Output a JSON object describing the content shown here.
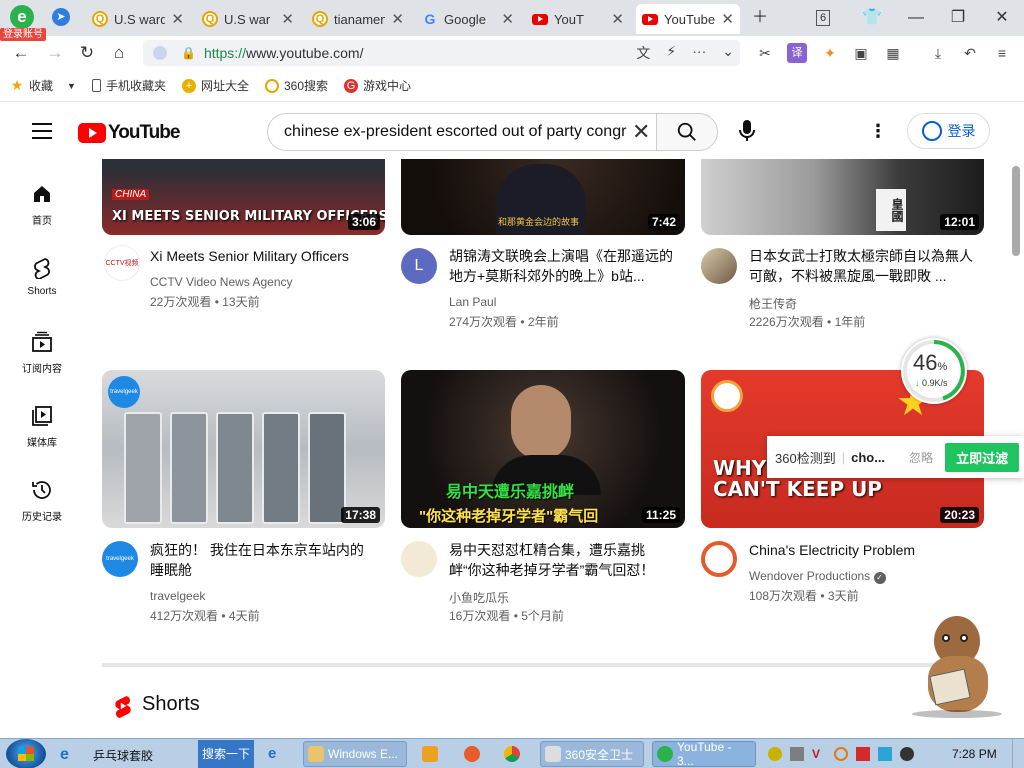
{
  "browser": {
    "login_badge": "登录账号",
    "tabs": [
      {
        "label": "U.S ward",
        "icon": "search-q-icon"
      },
      {
        "label": "U.S war",
        "icon": "search-q-icon"
      },
      {
        "label": "tianamen",
        "icon": "search-q-icon"
      },
      {
        "label": "Google",
        "icon": "google-icon"
      },
      {
        "label": "YouT",
        "icon": "youtube-icon"
      },
      {
        "label": "YouTube",
        "icon": "youtube-icon"
      }
    ],
    "tab_count": "6",
    "url_prefix": "https://",
    "url_rest": "www.youtube.com/",
    "bookmarks": [
      {
        "label": "收藏",
        "icon": "star-icon"
      },
      {
        "label": "手机收藏夹",
        "icon": "phone-icon"
      },
      {
        "label": "网址大全",
        "icon": "nav-icon"
      },
      {
        "label": "360搜索",
        "icon": "360-search-icon"
      },
      {
        "label": "游戏中心",
        "icon": "game-icon"
      }
    ]
  },
  "youtube": {
    "logo_text": "YouTube",
    "search_value": "chinese ex-president escorted out of party congr",
    "signin_label": "登录",
    "sidebar": [
      {
        "label": "首页"
      },
      {
        "label": "Shorts"
      },
      {
        "label": "订阅内容"
      },
      {
        "label": "媒体库"
      },
      {
        "label": "历史记录"
      }
    ],
    "videos": [
      {
        "thumb_text": "XI MEETS SENIOR MILITARY OFFICERS",
        "thumb_tag": "CHINA",
        "duration": "3:06",
        "avatar_text": "CCTV视频",
        "title": "Xi Meets Senior Military Officers",
        "channel": "CCTV Video News Agency",
        "views": "22万次观看",
        "age": "13天前"
      },
      {
        "thumb_text": "和那黄金会边的故事",
        "duration": "7:42",
        "avatar_text": "L",
        "title": "胡锦涛文联晚会上演唱《在那遥远的地方+莫斯科郊外的晚上》b站...",
        "channel": "Lan Paul",
        "views": "274万次观看",
        "age": "2年前"
      },
      {
        "thumb_text": "皇國",
        "duration": "12:01",
        "avatar_text": "",
        "title": "日本女武士打敗太極宗師自以為無人可敵，不料被黑旋風一戰即敗 ...",
        "channel": "枪王传奇",
        "views": "2226万次观看",
        "age": "1年前"
      },
      {
        "thumb_text": "travelgeek",
        "duration": "17:38",
        "avatar_text": "travelgeek",
        "title": "疯狂的！ 我住在日本东京车站内的睡眠舱",
        "channel": "travelgeek",
        "views": "412万次观看",
        "age": "4天前"
      },
      {
        "thumb_text": "易中天遭乐嘉挑衅",
        "thumb_text2": "\"你这种老掉牙学者\"霸气回",
        "duration": "11:25",
        "avatar_text": "",
        "title": "易中天怼怼杠精合集，遭乐嘉挑衅“你这种老掉牙学者”霸气回怼！",
        "channel": "小鱼吃瓜乐",
        "views": "16万次观看",
        "age": "5个月前"
      },
      {
        "thumb_text": "WHY THEIR GRID CAN'T KEEP UP",
        "duration": "20:23",
        "avatar_text": "",
        "title": "China's Electricity Problem",
        "channel": "Wendover Productions",
        "views": "108万次观看",
        "age": "3天前"
      }
    ],
    "shorts_heading": "Shorts"
  },
  "overlay": {
    "gauge_percent": "46",
    "gauge_unit": "%",
    "gauge_speed": "0.9K/s",
    "notice_text": "360检测到",
    "notice_query": "cho...",
    "notice_ignore": "忽略",
    "notice_button": "立即过滤"
  },
  "taskbar": {
    "ie_text": "乒乓球套胶",
    "search_button": "搜索一下",
    "items": [
      {
        "label": "Windows E..."
      },
      {
        "label": ""
      },
      {
        "label": ""
      },
      {
        "label": ""
      },
      {
        "label": "360安全卫士"
      },
      {
        "label": "YouTube - 3..."
      }
    ],
    "clock": "7:28 PM"
  },
  "colors": {
    "youtube_red": "#ff0000",
    "link_blue": "#065fd4",
    "green_360": "#2bb24c",
    "notice_green": "#1fc35f"
  }
}
